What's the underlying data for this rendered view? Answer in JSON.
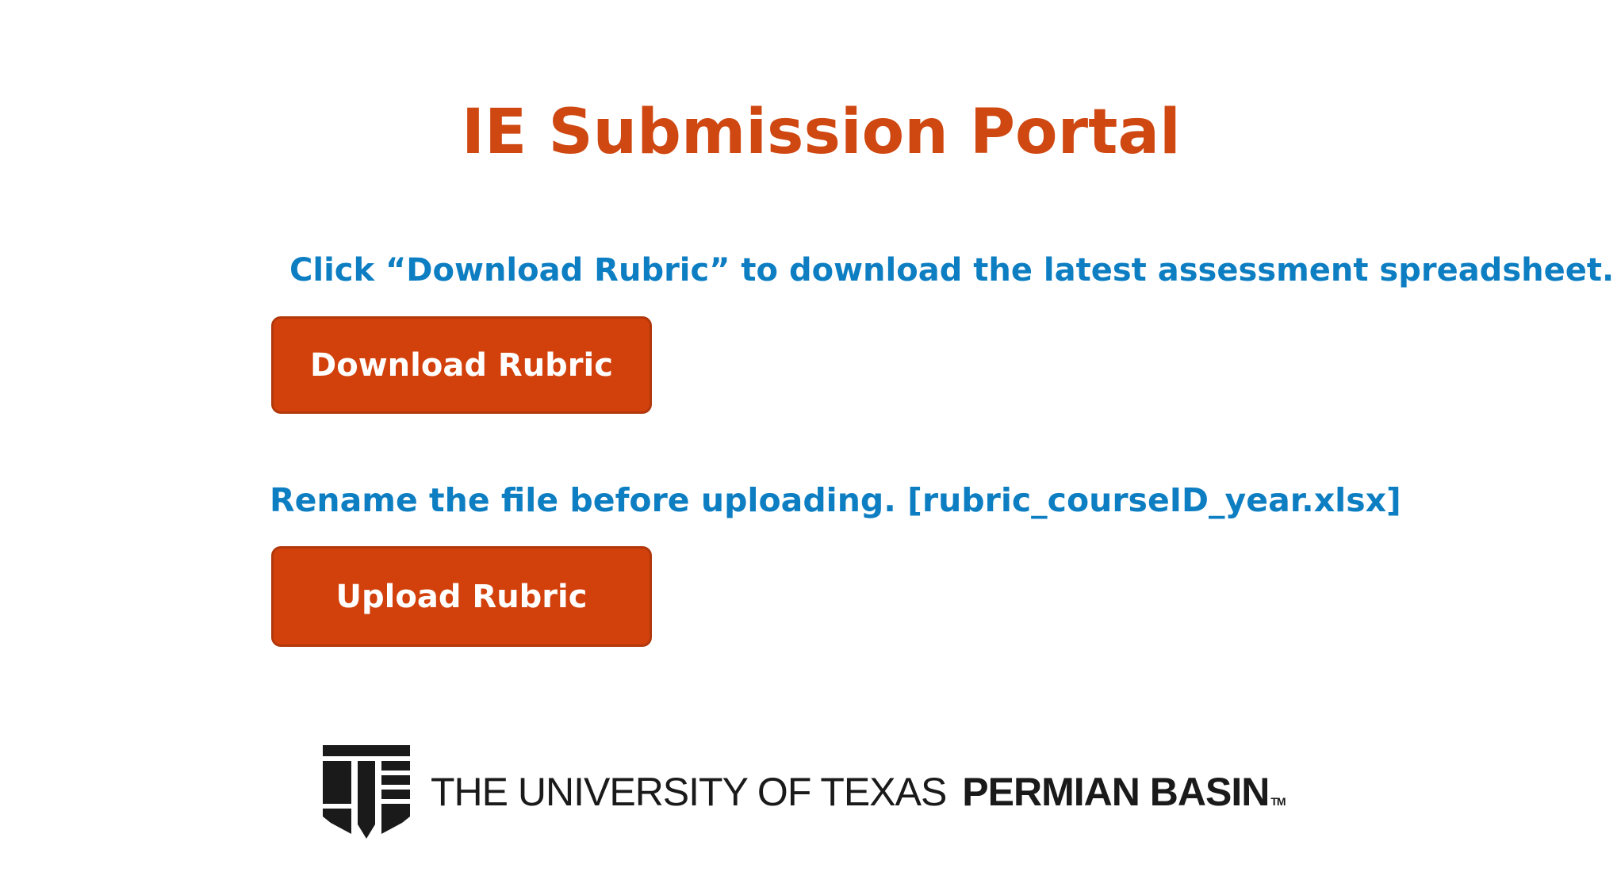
{
  "page": {
    "title": "IE Submission Portal"
  },
  "download_section": {
    "instruction": "Click “Download Rubric” to download the latest assessment spreadsheet.",
    "button_label": "Download Rubric"
  },
  "upload_section": {
    "instruction": "Rename the file before uploading. [rubric_courseID_year.xlsx]",
    "button_label": "Upload Rubric"
  },
  "footer_logo": {
    "text_regular": "THE UNIVERSITY OF TEXAS",
    "text_bold": "PERMIAN BASIN",
    "trademark": "TM"
  },
  "colors": {
    "title": "#cf4711",
    "instruction_text": "#0d7ec2",
    "button_background": "#d2410c",
    "button_text": "#ffffff",
    "logo": "#1a1a1a"
  }
}
